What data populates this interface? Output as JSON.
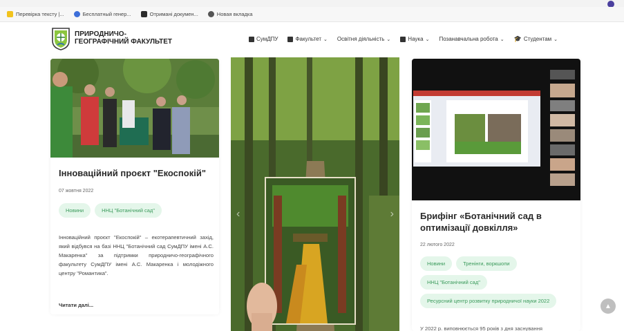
{
  "browser": {
    "bookmarks": [
      {
        "label": "Перевірка тексту |...",
        "icon": "yellow-doc-icon"
      },
      {
        "label": "Бесплатный генер...",
        "icon": "generator-icon"
      },
      {
        "label": "Отримані докумен...",
        "icon": "documents-icon"
      },
      {
        "label": "Новая вкладка",
        "icon": "globe-icon"
      }
    ]
  },
  "header": {
    "title": "Природничо-географічний факультет",
    "nav": [
      {
        "label": "СумДПУ",
        "icon": "university-icon",
        "dropdown": false
      },
      {
        "label": "Факультет",
        "icon": "building-icon",
        "dropdown": true
      },
      {
        "label": "Освітня діяльність",
        "icon": "",
        "dropdown": true
      },
      {
        "label": "Наука",
        "icon": "book-icon",
        "dropdown": true
      },
      {
        "label": "Позанавчальна робота",
        "icon": "",
        "dropdown": true
      },
      {
        "label": "Студентам",
        "icon": "graduation-cap-icon",
        "dropdown": true
      }
    ]
  },
  "posts": [
    {
      "title": "Інноваційний проєкт \"Екоспокій\"",
      "date": "07 жовтня 2022",
      "tags": [
        "Новини",
        "ННЦ \"Ботанічний сад\""
      ],
      "excerpt": "Інноваційний проєкт \"Екоспокій\" – екотерапевтичний захід, який відбувся на базі ННЦ \"Ботанічний сад СумДПУ імені А.С. Макаренка\" за підтримки природничо-географічного факультету СумДПУ імені А.С. Макаренка і молодіжного центру \"Романтика\".",
      "read_more": "Читати далі..."
    },
    {
      "title": "Брифінг «Ботанічний сад в оптимізації довкілля»",
      "date": "22 лютого 2022",
      "tags": [
        "Новини",
        "Тренінги, воркшопи",
        "ННЦ \"Ботанічний сад\"",
        "Ресурсний центр розвитку природничої науки 2022"
      ],
      "excerpt": "У 2022 р. виповнюється 95 років з дня заснування"
    }
  ],
  "colors": {
    "tag_bg": "#e4f6ea",
    "tag_text": "#3a9a5b",
    "accent_logo": "#8cc63f"
  }
}
